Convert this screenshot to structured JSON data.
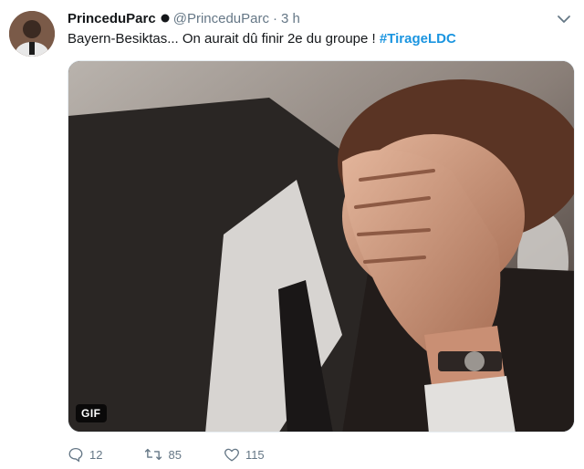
{
  "tweet": {
    "display_name": "PrinceduParc",
    "handle": "@PrinceduParc",
    "separator": "·",
    "time": "3 h",
    "text": "Bayern-Besiktas... On aurait dû finir 2e du groupe ! ",
    "hashtag": "#TirageLDC",
    "media_badge": "GIF"
  },
  "actions": {
    "reply_count": "12",
    "retweet_count": "85",
    "like_count": "115"
  },
  "icons": {
    "verified": "dot-badge-icon",
    "menu": "chevron-down-icon",
    "reply": "reply-icon",
    "retweet": "retweet-icon",
    "like": "heart-icon"
  },
  "colors": {
    "hashtag": "#1b95e0",
    "muted": "#657786",
    "text": "#14171a"
  }
}
